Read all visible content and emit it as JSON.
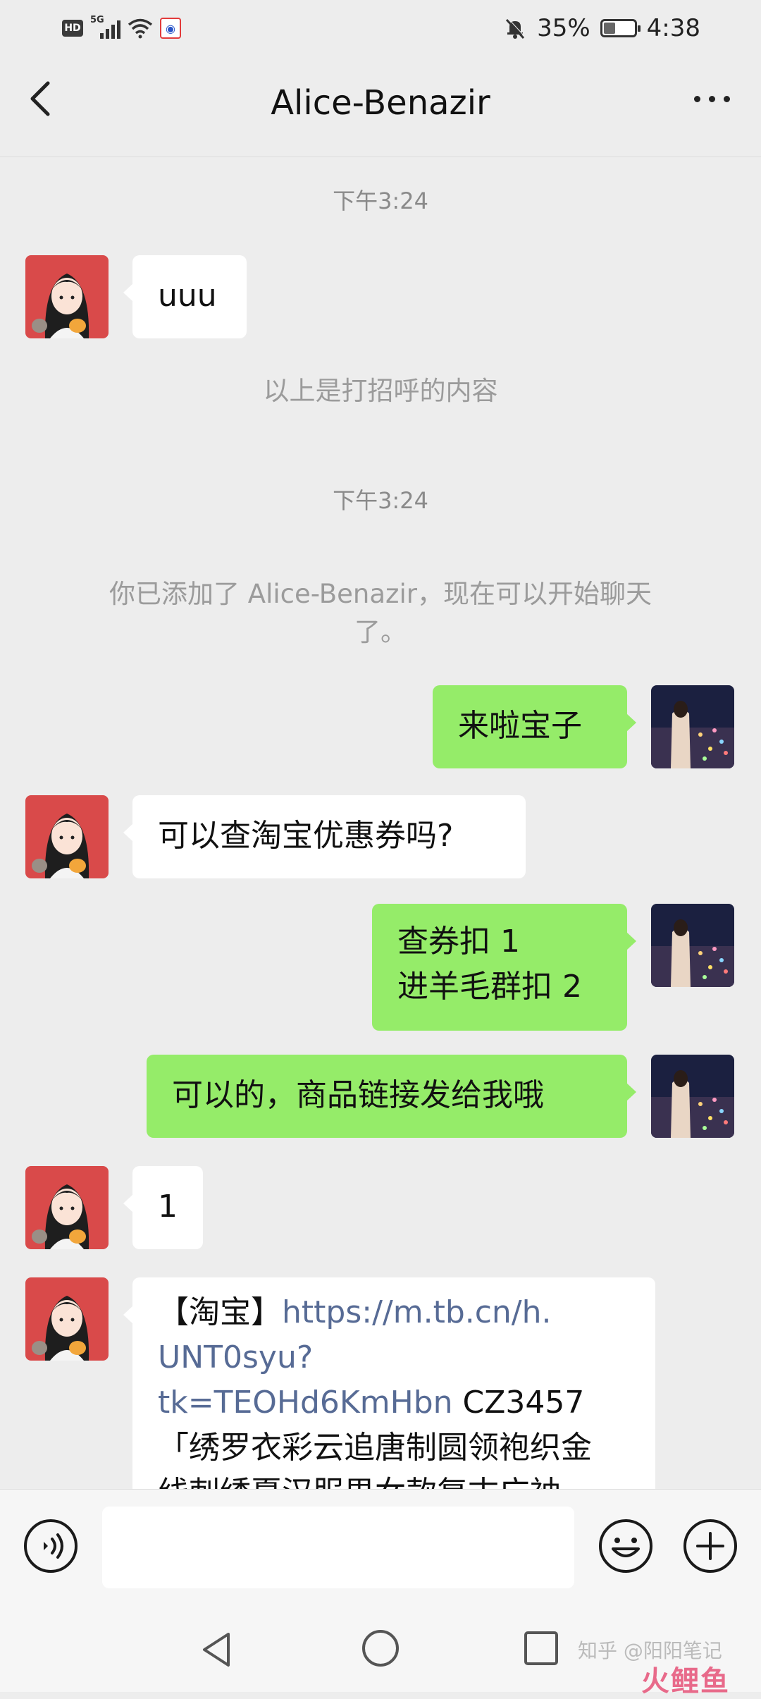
{
  "status_bar": {
    "hd": "HD",
    "network": "5G",
    "battery": "35%",
    "battery_level": 0.35,
    "time": "4:38"
  },
  "header": {
    "title": "Alice-Benazir"
  },
  "messages": {
    "time1": "下午3:24",
    "m1": "uuu",
    "sys1": "以上是打招呼的内容",
    "time2": "下午3:24",
    "sys2_line1": "你已添加了 Alice-Benazir，现在可以开始聊天",
    "sys2_line2": "了。",
    "m2": "来啦宝子",
    "m3": "可以查淘宝优惠券吗?",
    "m4_line1": "查券扣 1",
    "m4_line2": "进羊毛群扣 2",
    "m5": "可以的，商品链接发给我哦",
    "m6": "1",
    "m7_prefix": "【淘宝】",
    "m7_link1": "https://m.tb.cn/h.",
    "m7_link2": "UNT0syu?",
    "m7_link3": "tk=TEOHd6KmHbn",
    "m7_code": " CZ3457",
    "m7_line4": "「绣罗衣彩云追唐制圆领袍织金",
    "m7_line5": "线刺绣夏汉服男女款复古广袖"
  },
  "input_bar": {
    "placeholder": ""
  },
  "watermark": {
    "text": "知乎 @阳阳笔记",
    "logo": "火鲤鱼"
  },
  "colors": {
    "background": "#ededed",
    "outgoing_bubble": "#95ec69",
    "incoming_bubble": "#ffffff",
    "link": "#576b95"
  },
  "icons": {
    "back": "chevron-left-icon",
    "more": "more-dots-icon",
    "voice": "voice-icon",
    "emoji": "emoji-icon",
    "plus": "plus-icon",
    "mute": "bell-off-icon"
  }
}
